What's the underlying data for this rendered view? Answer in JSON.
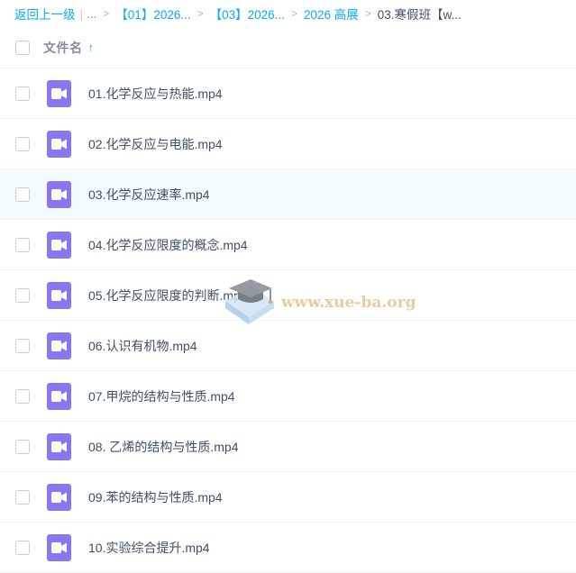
{
  "breadcrumb": {
    "back_label": "返回上一级",
    "ellipsis": "...",
    "crumbs": [
      "【01】2026...",
      "【03】2026...",
      "2026 高展"
    ],
    "current": "03.寒假班【w..."
  },
  "header": {
    "column_label": "文件名",
    "sort_icon": "arrow-up-icon"
  },
  "files": [
    {
      "name": "01.化学反应与热能.mp4"
    },
    {
      "name": "02.化学反应与电能.mp4"
    },
    {
      "name": "03.化学反应速率.mp4"
    },
    {
      "name": "04.化学反应限度的概念.mp4"
    },
    {
      "name": "05.化学反应限度的判断.mp4"
    },
    {
      "name": "06.认识有机物.mp4"
    },
    {
      "name": "07.甲烷的结构与性质.mp4"
    },
    {
      "name": "08. 乙烯的结构与性质.mp4"
    },
    {
      "name": "09.苯的结构与性质.mp4"
    },
    {
      "name": "10.实验综合提升.mp4"
    }
  ],
  "watermark": {
    "text": "www.xue-ba.org"
  },
  "colors": {
    "link": "#09aaff",
    "video_icon": "#8a76f0",
    "hover_row": "#f4fbff",
    "watermark": "#e8bd8a"
  }
}
